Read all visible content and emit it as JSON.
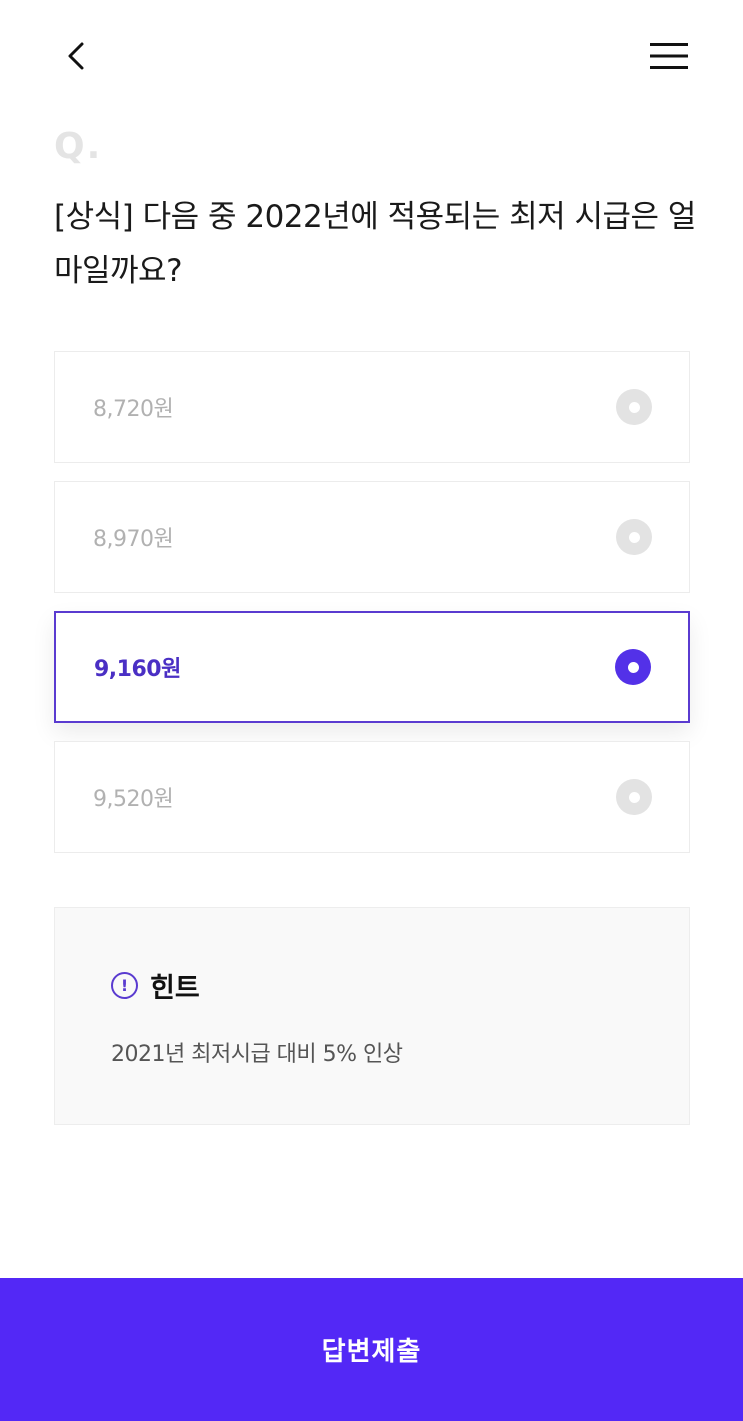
{
  "header": {
    "back_icon": "chevron-left-icon",
    "menu_icon": "hamburger-menu-icon"
  },
  "question": {
    "marker": "Q.",
    "text": "[상식] 다음 중 2022년에 적용되는 최저 시급은 얼마일까요?"
  },
  "options": [
    {
      "label": "8,720원",
      "selected": false
    },
    {
      "label": "8,970원",
      "selected": false
    },
    {
      "label": "9,160원",
      "selected": true
    },
    {
      "label": "9,520원",
      "selected": false
    }
  ],
  "hint": {
    "icon": "exclamation-circle-icon",
    "icon_glyph": "!",
    "title": "힌트",
    "text": "2021년 최저시급 대비 5% 인상"
  },
  "submit": {
    "label": "답변제출"
  },
  "colors": {
    "accent": "#5328f6",
    "selected_border": "#5a3bd0",
    "selected_text": "#4a2fc4",
    "unselected_text": "#b1b1b1",
    "radio_off": "#e3e3e3"
  }
}
